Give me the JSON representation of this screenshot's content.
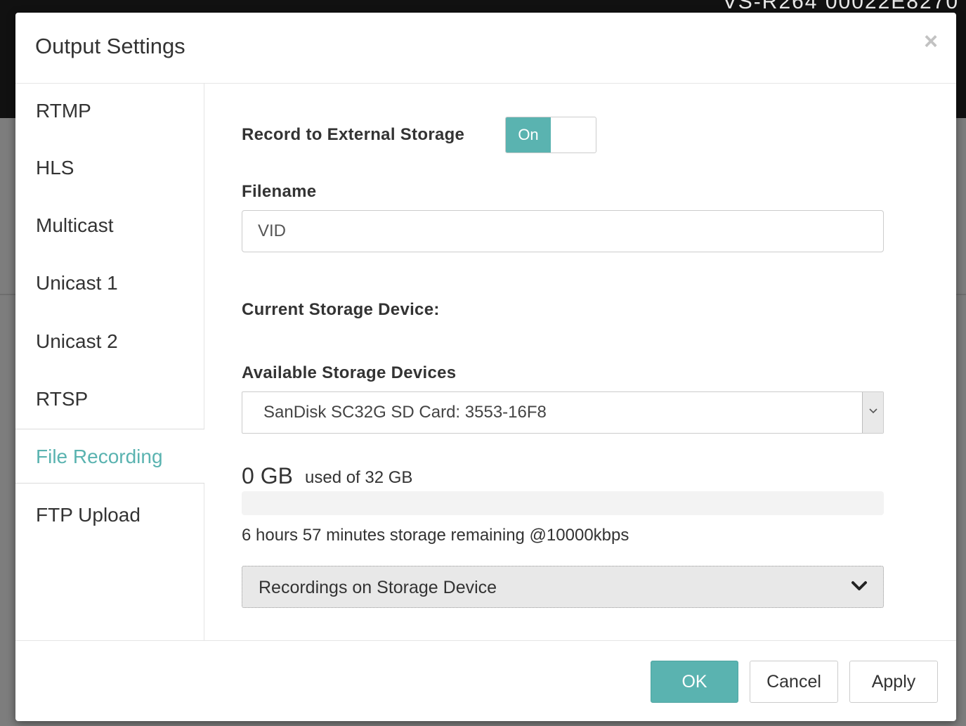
{
  "background": {
    "header_text": "VS-R264 00022E8270"
  },
  "modal": {
    "title": "Output Settings",
    "close_glyph": "×"
  },
  "sidebar": {
    "items": [
      {
        "label": "RTMP"
      },
      {
        "label": "HLS"
      },
      {
        "label": "Multicast"
      },
      {
        "label": "Unicast 1"
      },
      {
        "label": "Unicast 2"
      },
      {
        "label": "RTSP"
      },
      {
        "label": "File Recording",
        "active": true
      },
      {
        "label": "FTP Upload"
      }
    ]
  },
  "content": {
    "record_label": "Record to External Storage",
    "record_toggle": "On",
    "filename_label": "Filename",
    "filename_value": "VID",
    "current_device_label": "Current Storage Device:",
    "available_devices_label": "Available Storage Devices",
    "selected_device": "SanDisk SC32G SD Card: 3553-16F8",
    "used_amount": "0 GB",
    "used_suffix": "used of 32 GB",
    "used_fraction": 0,
    "remaining_text": "6 hours 57 minutes storage remaining @10000kbps",
    "recordings_label": "Recordings on Storage Device"
  },
  "footer": {
    "ok_label": "OK",
    "cancel_label": "Cancel",
    "apply_label": "Apply"
  },
  "colors": {
    "accent": "#5ab3b0"
  }
}
